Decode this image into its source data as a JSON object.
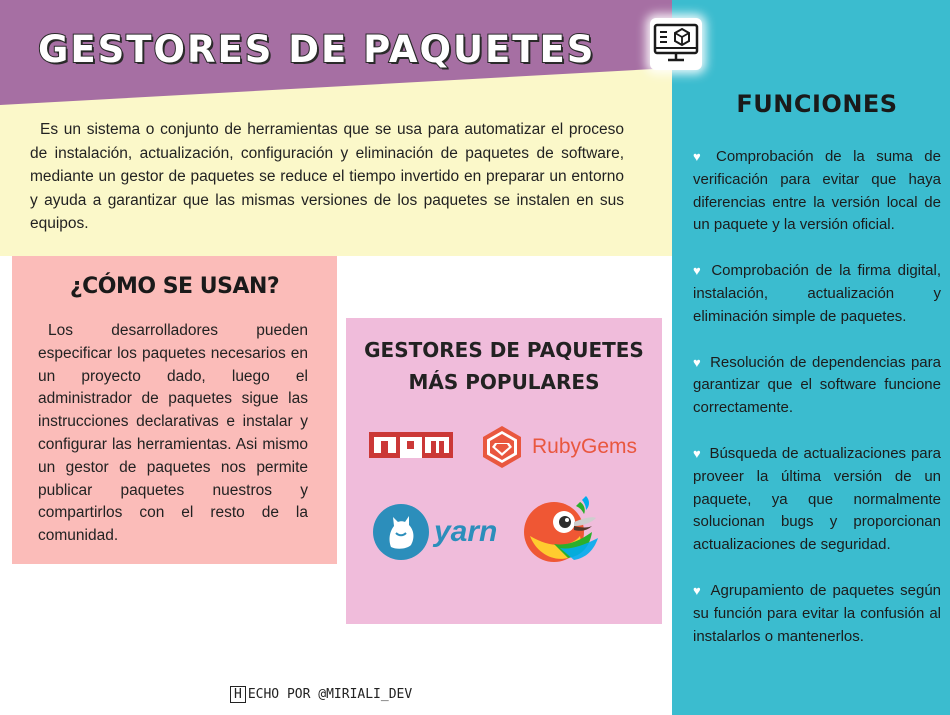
{
  "header": {
    "title": "GESTORES DE PAQUETES"
  },
  "intro": {
    "text": "Es un sistema o conjunto de herramientas que se usa para automatizar el proceso de instalación, actualización, configuración y eliminación de paquetes de software, mediante un gestor de paquetes se reduce el tiempo invertido en preparar un entorno y ayuda a garantizar que las mismas versiones de los paquetes se instalen en sus equipos."
  },
  "usage": {
    "title": "¿CÓMO SE USAN?",
    "text": "Los desarrolladores pueden especificar los paquetes necesarios en un proyecto dado, luego el administrador de paquetes sigue las instrucciones declarativas e instalar y configurar las herramientas. Asi mismo un gestor de paquetes nos permite publicar paquetes nuestros y compartirlos con el resto de la comunidad."
  },
  "popular": {
    "title": "GESTORES DE PAQUETES MÁS POPULARES",
    "logos": [
      {
        "name": "npm",
        "label": "npm"
      },
      {
        "name": "rubygems",
        "label": "RubyGems"
      },
      {
        "name": "yarn",
        "label": "yarn"
      },
      {
        "name": "bower",
        "label": ""
      }
    ]
  },
  "funciones": {
    "title": "FUNCIONES",
    "bullet_icon": "heart-icon",
    "items": [
      "Comprobación de la suma de verificación para evitar que haya diferencias entre la versión local de un paquete y la versión oficial.",
      "Comprobación de la firma digital, instalación, actualización y eliminación simple de paquetes.",
      "Resolución de dependencias para garantizar que el software funcione correctamente.",
      "Búsqueda de actualizaciones para proveer la última versión de un paquete, ya que normalmente solucionan bugs y proporcionan actualizaciones de seguridad.",
      "Agrupamiento de paquetes según su función para evitar la confusión al instalarlos o mantenerlos."
    ]
  },
  "footer": {
    "badge": "H",
    "text": "ECHO POR @MIRIALI_DEV"
  },
  "colors": {
    "purple": "#a66fa3",
    "cream": "#fbf8c9",
    "teal": "#3bbccf",
    "salmon": "#fbbcb9",
    "pink": "#f0bcdb",
    "npm_red": "#cb3837",
    "ruby_red": "#e9573f",
    "yarn_blue": "#2c8ebb"
  }
}
